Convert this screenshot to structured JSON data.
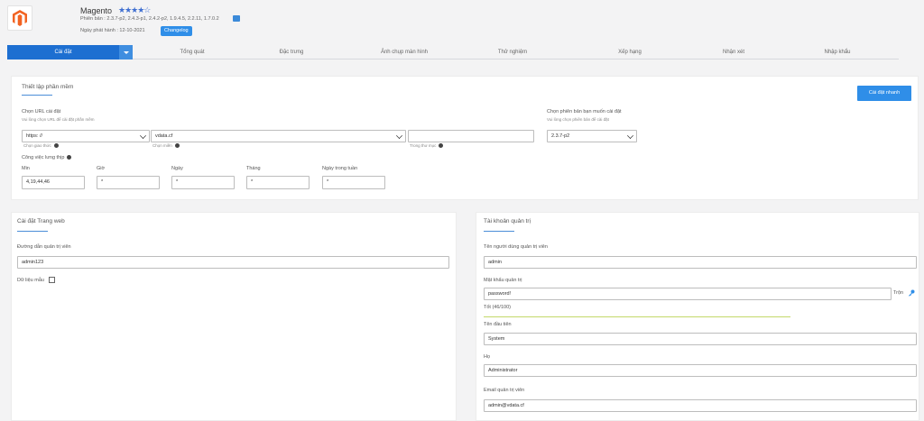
{
  "header": {
    "app_name": "Magento",
    "stars": "★★★★☆",
    "versions": "Phiên bản : 2.3.7-p2, 2.4.3-p1, 2.4.2-p2, 1.9.4.5, 2.2.11, 1.7.0.2",
    "release_date": "Ngày phát hành : 12-10-2021",
    "changelog_label": "Changelog"
  },
  "tabs": [
    "Cài đặt",
    "Tổng quát",
    "Đặc trưng",
    "Ảnh chụp màn hình",
    "Thử nghiệm",
    "Xếp hạng",
    "Nhận xét",
    "Nhập khẩu"
  ],
  "install_panel": {
    "title": "Thiết lập phần mềm",
    "quick_install_label": "Cài đặt nhanh",
    "url_label": "Chọn URL cài đặt",
    "url_sub": "Vui lòng chọn URL để cài đặt phần mềm",
    "protocol_value": "https: //",
    "protocol_hint": "Chọn giao thức",
    "domain_value": "vdata.cf",
    "domain_hint": "Chọn miền",
    "directory_value": "",
    "directory_hint": "Trong thư mục",
    "version_label": "Chọn phiên bản bạn muốn cài đặt",
    "version_sub": "Vui lòng chọn phiên bản để cài đặt",
    "version_value": "2.3.7-p2",
    "cron_label": "Công việc lưng thịp",
    "cron_fields": [
      {
        "label": "Min",
        "value": "4,19,44,46"
      },
      {
        "label": "Giờ",
        "value": "*"
      },
      {
        "label": "Ngày",
        "value": "*"
      },
      {
        "label": "Tháng",
        "value": "*"
      },
      {
        "label": "Ngày trong tuần",
        "value": "*"
      }
    ]
  },
  "site_panel": {
    "title": "Cài đặt Trang web",
    "admin_path_label": "Đường dẫn quản trị viên",
    "admin_path_value": "admin123",
    "sample_data_label": "Dữ liệu mẫu"
  },
  "admin_panel": {
    "title": "Tài khoản quản trị",
    "username_label": "Tên người dùng quản trị viên",
    "username_value": "admin",
    "password_label": "Mật khẩu quản trị",
    "password_value": "password!",
    "random_label": "Trộn",
    "strength_text": "Tốt (46/100)",
    "firstname_label": "Tên đầu tiên",
    "firstname_value": "System",
    "lastname_label": "Họ",
    "lastname_value": "Administrator",
    "email_label": "Email quản trị viên",
    "email_value": "admin@vdata.cf"
  },
  "colors": {
    "accent": "#2f8ee8",
    "tab_active": "#1d6fd1",
    "logo": "#f26322"
  }
}
